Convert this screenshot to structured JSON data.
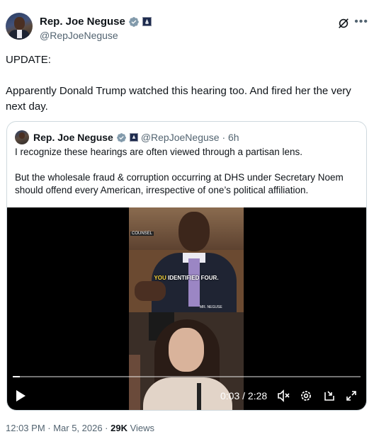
{
  "author": {
    "name": "Rep. Joe Neguse",
    "handle": "@RepJoeNeguse"
  },
  "tweet": {
    "paragraphs": [
      "UPDATE:",
      "Apparently Donald Trump watched this hearing too. And fired her the very next day."
    ]
  },
  "quoted": {
    "name": "Rep. Joe Neguse",
    "handle_time": "@RepJoeNeguse · 6h",
    "paragraphs": [
      "I recognize these hearings are often viewed through a partisan lens.",
      "But the wholesale fraud & corruption occurring at DHS under Secretary Noem should offend every American, irrespective of one’s political affiliation."
    ]
  },
  "video": {
    "caption_highlight": "YOU",
    "caption_rest": " IDENTIFIED FOUR.",
    "label_left": "COUNSEL",
    "label_right": "MR. NEGUSE",
    "time": "0:03 / 2:28",
    "progress_fraction": 0.02
  },
  "meta": {
    "timestamp": "12:03 PM · Mar 5, 2026 · ",
    "views_count": "29K",
    "views_label": " Views"
  },
  "colors": {
    "verified": "#1d9bf0",
    "secondary_text": "#536471",
    "border": "#cfd9de"
  }
}
